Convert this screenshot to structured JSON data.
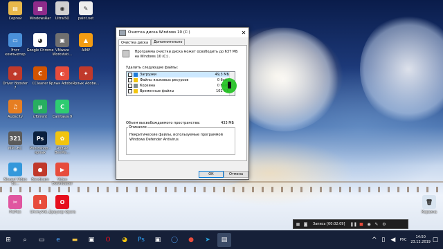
{
  "desktop": {
    "icons": [
      {
        "label": "Сергей",
        "color": "#e8b84a",
        "glyph": "▤"
      },
      {
        "label": "WindowsRar",
        "color": "#8e2b8a",
        "glyph": "▦"
      },
      {
        "label": "UltraISO",
        "color": "#d0d0d0",
        "glyph": "◉"
      },
      {
        "label": "paint.net",
        "color": "#eeeeee",
        "glyph": "✎"
      },
      {
        "label": "Этот компьютер",
        "color": "#4a90d9",
        "glyph": "▭"
      },
      {
        "label": "Google Chrome",
        "color": "#ffffff",
        "glyph": "◕"
      },
      {
        "label": "VMware Workstati...",
        "color": "#707070",
        "glyph": "▣"
      },
      {
        "label": "AIMP",
        "color": "#f39c12",
        "glyph": "▲"
      },
      {
        "label": "Driver Booster 7",
        "color": "#c0392b",
        "glyph": "◈"
      },
      {
        "label": "CCleaner",
        "color": "#d35400",
        "glyph": "C"
      },
      {
        "label": "Ярлык Adobe...",
        "color": "#e74c3c",
        "glyph": "◐"
      },
      {
        "label": "Ярлык Adobe...",
        "color": "#c0392b",
        "glyph": "✦"
      },
      {
        "label": "Audacity",
        "color": "#e67e22",
        "glyph": "♫"
      },
      {
        "label": "uTorrent",
        "color": "#27ae60",
        "glyph": "µ"
      },
      {
        "label": "Camtasia 9",
        "color": "#2ecc71",
        "glyph": "C"
      },
      {
        "label": "MPC-HC",
        "color": "#5a5a5a",
        "glyph": "321"
      },
      {
        "label": "Photoshop - ярлык",
        "color": "#0a1f3d",
        "glyph": "Ps"
      },
      {
        "label": "Ярлык BeeMa...",
        "color": "#f1c40f",
        "glyph": "✿"
      },
      {
        "label": "Movavi Video Su...",
        "color": "#3498db",
        "glyph": "✺"
      },
      {
        "label": "Bandicam",
        "color": "#c0392b",
        "glyph": "●"
      },
      {
        "label": "Video Downloader",
        "color": "#e74c3c",
        "glyph": "▶"
      },
      {
        "label": "PicPick",
        "color": "#e056a0",
        "glyph": "✂"
      },
      {
        "label": "UmmyVid...",
        "color": "#e74c3c",
        "glyph": "⬇"
      },
      {
        "label": "Браузер Opera",
        "color": "#e60f1e",
        "glyph": "O"
      },
      {
        "label": "Корзина",
        "color": "#d8e4f0",
        "glyph": "🗑"
      }
    ]
  },
  "dialog": {
    "title": "Очистка диска Windows 10 (C:)",
    "tabs": [
      "Очистка диска",
      "Дополнительно"
    ],
    "intro": "Программа очистки диска может освободить до 637 МБ на Windows 10 (C:).",
    "delete_heading": "Удалить следующие файлы:",
    "files": [
      {
        "name": "Загрузки",
        "size": "49,3 МБ",
        "checked": false,
        "icon_color": "#1e7ad6"
      },
      {
        "name": "Файлы языковых ресурсов",
        "size": "0 байт",
        "checked": false,
        "icon_color": "#f1c40f"
      },
      {
        "name": "Корзина",
        "size": "0 байт",
        "checked": false,
        "icon_color": "#7f8c8d"
      },
      {
        "name": "Временные файлы",
        "size": "102 МБ",
        "checked": false,
        "icon_color": "#f1c40f"
      }
    ],
    "total_label": "Объем высвобождаемого пространства:",
    "total_value": "433 МБ",
    "description_label": "Описание",
    "description": "Некритические файлы, используемые программой Windows Defender Antivirus",
    "ok": "ОК",
    "cancel": "Отмена"
  },
  "recorder": {
    "label": "Запись [00:02:09]"
  },
  "taskbar": {
    "lang": "РУС",
    "time": "14:50",
    "date": "23.12.2019"
  }
}
